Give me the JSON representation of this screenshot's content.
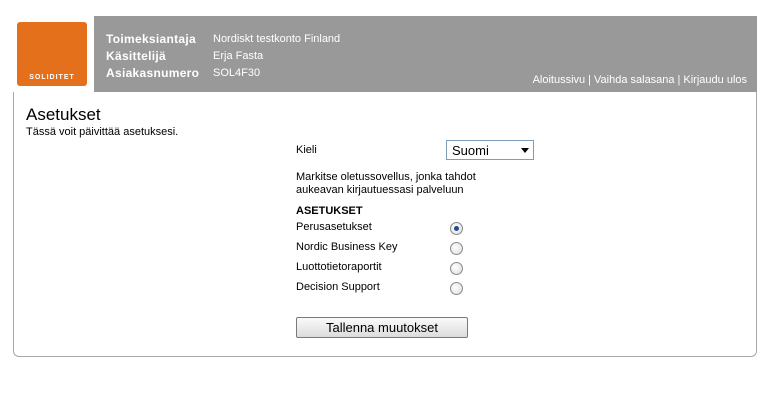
{
  "header": {
    "logo_text": "SOLIDITET",
    "brand_color": "#e5701b",
    "info": [
      {
        "label": "Toimeksiantaja",
        "value": "Nordiskt testkonto Finland"
      },
      {
        "label": "Käsittelijä",
        "value": "Erja Fasta"
      },
      {
        "label": "Asiakasnumero",
        "value": "SOL4F30"
      }
    ],
    "links": [
      "Aloitussivu",
      "Vaihda salasana",
      "Kirjaudu ulos"
    ],
    "link_separator": "|"
  },
  "page": {
    "title": "Asetukset",
    "subtitle": "Tässä voit päivittää asetuksesi."
  },
  "form": {
    "language_label": "Kieli",
    "language_value": "Suomi",
    "default_app_text_1": "Markitse oletussovellus, jonka tahdot",
    "default_app_text_2": "aukeavan kirjautuessasi palveluun",
    "section_heading": "ASETUKSET",
    "options": [
      {
        "label": "Perusasetukset",
        "checked": true
      },
      {
        "label": "Nordic Business Key",
        "checked": false
      },
      {
        "label": "Luottotietoraportit",
        "checked": false
      },
      {
        "label": "Decision Support",
        "checked": false
      }
    ],
    "save_label": "Tallenna muutokset"
  }
}
